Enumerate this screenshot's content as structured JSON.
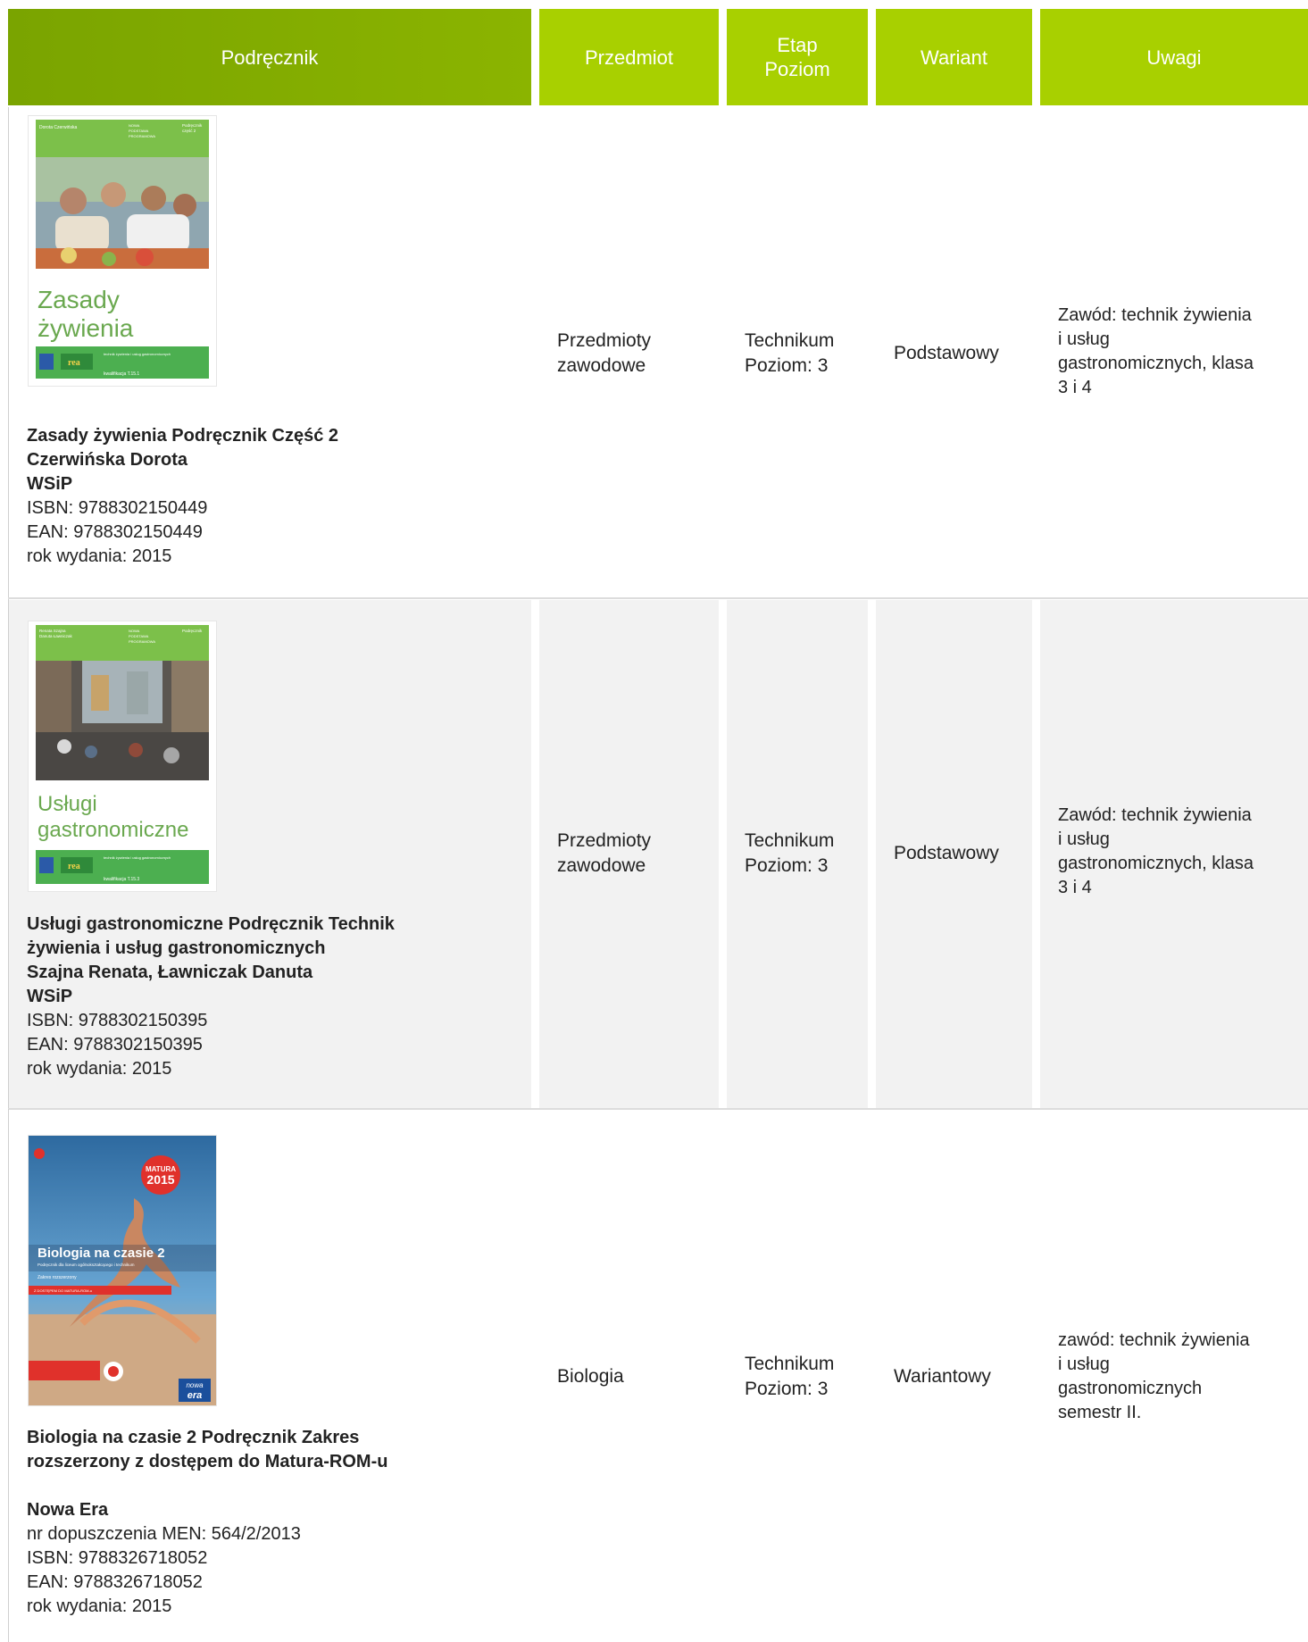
{
  "header": {
    "book": "Podręcznik",
    "subject": "Przedmiot",
    "etap_line1": "Etap",
    "etap_line2": "Poziom",
    "variant": "Wariant",
    "notes": "Uwagi"
  },
  "rows": [
    {
      "cover": {
        "author": "Dorota Czerwińska",
        "tag1": "NOWA",
        "tag2": "PODSTAWA",
        "tag3": "PROGRAMOWA",
        "badge1": "Podręcznik",
        "badge2": "część 2",
        "title1": "Zasady",
        "title2": "żywienia",
        "logo1": "rea",
        "qual_line": "technik żywienia i usług gastronomicznych",
        "qual": "kwalifikacja T.15.1"
      },
      "title": "Zasady żywienia Podręcznik Część 2",
      "author": "Czerwińska Dorota",
      "publisher": "WSiP",
      "isbn": "ISBN: 9788302150449",
      "ean": "EAN: 9788302150449",
      "year": "rok wydania: 2015",
      "subject_line1": "Przedmioty",
      "subject_line2": "zawodowe",
      "etap_line1": "Technikum",
      "etap_line2": "Poziom: 3",
      "variant": "Podstawowy",
      "note_line1": "Zawód: technik żywienia",
      "note_line2": "i usług",
      "note_line3": "gastronomicznych, klasa",
      "note_line4": "3 i 4"
    },
    {
      "cover": {
        "author1": "Renata Szajna",
        "author2": "Danuta Ławniczak",
        "tag1": "NOWA",
        "tag2": "PODSTAWA",
        "tag3": "PROGRAMOWA",
        "badge1": "Podręcznik",
        "title1": "Usługi",
        "title2": "gastronomiczne",
        "logo1": "rea",
        "qual_line": "technik żywienia i usług gastronomicznych",
        "qual": "kwalifikacja T.15.3"
      },
      "title_line1": "Usługi gastronomiczne Podręcznik Technik",
      "title_line2": "żywienia i usług gastronomicznych",
      "author": "Szajna Renata, Ławniczak Danuta",
      "publisher": "WSiP",
      "isbn": "ISBN: 9788302150395",
      "ean": "EAN: 9788302150395",
      "year": "rok wydania: 2015",
      "subject_line1": "Przedmioty",
      "subject_line2": "zawodowe",
      "etap_line1": "Technikum",
      "etap_line2": "Poziom: 3",
      "variant": "Podstawowy",
      "note_line1": "Zawód: technik żywienia",
      "note_line2": "i usług",
      "note_line3": "gastronomicznych, klasa",
      "note_line4": "3 i 4"
    },
    {
      "cover": {
        "badge_top": "MATURA",
        "badge_year": "2015",
        "title": "Biologia na czasie 2",
        "subtitle": "Podręcznik dla liceum ogólnokształcącego i technikum",
        "range": "Zakres rozszerzony",
        "access": "Z DOSTĘPEM DO MATURA-ROM-u",
        "logo1": "nowa",
        "logo2": "era"
      },
      "title_line1": "Biologia na czasie 2 Podręcznik Zakres",
      "title_line2": "rozszerzony z dostępem do Matura-ROM-u",
      "publisher": "Nowa Era",
      "approval": "nr dopuszczenia MEN: 564/2/2013",
      "isbn": "ISBN: 9788326718052",
      "ean": "EAN: 9788326718052",
      "year": "rok wydania: 2015",
      "subject": "Biologia",
      "etap_line1": "Technikum",
      "etap_line2": "Poziom: 3",
      "variant": "Wariantowy",
      "note_line1": "zawód: technik żywienia",
      "note_line2": "i usług",
      "note_line3": "gastronomicznych",
      "note_line4": "semestr II."
    }
  ],
  "colors": {
    "header_dark": "#7aa400",
    "header_light": "#a8d000",
    "row_alt": "#f2f2f2"
  }
}
